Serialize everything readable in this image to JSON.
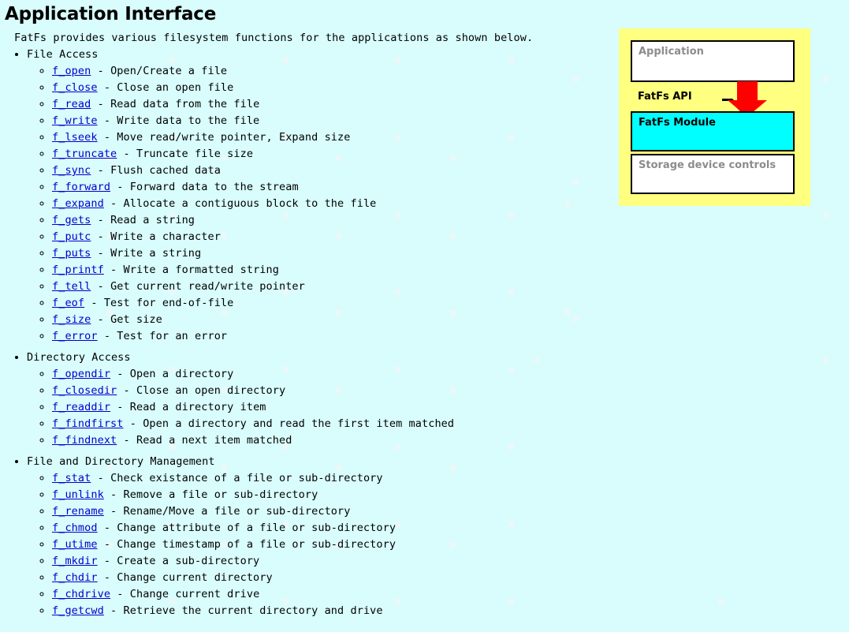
{
  "page": {
    "title": "Application Interface",
    "intro": "FatFs provides various filesystem functions for the applications as shown below.",
    "background_color": "#d9fcfc",
    "link_color": "#0000cc",
    "text_color": "#000000"
  },
  "groups": [
    {
      "label": "File Access",
      "items": [
        {
          "name": "f_open",
          "sep": " - ",
          "desc": "Open/Create a file"
        },
        {
          "name": "f_close",
          "sep": " - ",
          "desc": "Close an open file"
        },
        {
          "name": "f_read",
          "sep": " - ",
          "desc": "Read data from the file"
        },
        {
          "name": "f_write",
          "sep": " - ",
          "desc": "Write data to the file"
        },
        {
          "name": "f_lseek",
          "sep": " - ",
          "desc": "Move read/write pointer, Expand size"
        },
        {
          "name": "f_truncate",
          "sep": " - ",
          "desc": "Truncate file size"
        },
        {
          "name": "f_sync",
          "sep": " - ",
          "desc": "Flush cached data"
        },
        {
          "name": "f_forward",
          "sep": " - ",
          "desc": "Forward data to the stream"
        },
        {
          "name": "f_expand",
          "sep": " - ",
          "desc": "Allocate a contiguous block to the file"
        },
        {
          "name": "f_gets",
          "sep": " - ",
          "desc": "Read a string"
        },
        {
          "name": "f_putc",
          "sep": " - ",
          "desc": "Write a character"
        },
        {
          "name": "f_puts",
          "sep": " - ",
          "desc": "Write a string"
        },
        {
          "name": "f_printf",
          "sep": " - ",
          "desc": "Write a formatted string"
        },
        {
          "name": "f_tell",
          "sep": " - ",
          "desc": "Get current read/write pointer"
        },
        {
          "name": "f_eof",
          "sep": " - ",
          "desc": "Test for end-of-file"
        },
        {
          "name": "f_size",
          "sep": " - ",
          "desc": "Get size"
        },
        {
          "name": "f_error",
          "sep": " - ",
          "desc": "Test for an error"
        }
      ]
    },
    {
      "label": "Directory Access",
      "items": [
        {
          "name": "f_opendir",
          "sep": " - ",
          "desc": "Open a directory"
        },
        {
          "name": "f_closedir",
          "sep": " - ",
          "desc": "Close an open directory"
        },
        {
          "name": "f_readdir",
          "sep": " - ",
          "desc": "Read a directory item"
        },
        {
          "name": "f_findfirst",
          "sep": " - ",
          "desc": "Open a directory and read the first item matched"
        },
        {
          "name": "f_findnext",
          "sep": " - ",
          "desc": "Read a next item matched"
        }
      ]
    },
    {
      "label": "File and Directory Management",
      "items": [
        {
          "name": "f_stat",
          "sep": " - ",
          "desc": "Check existance of a file or sub-directory"
        },
        {
          "name": "f_unlink",
          "sep": " - ",
          "desc": "Remove a file or sub-directory"
        },
        {
          "name": "f_rename",
          "sep": " - ",
          "desc": "Rename/Move a file or sub-directory"
        },
        {
          "name": "f_chmod",
          "sep": " - ",
          "desc": "Change attribute of a file or sub-directory"
        },
        {
          "name": "f_utime",
          "sep": " - ",
          "desc": "Change timestamp of a file or sub-directory"
        },
        {
          "name": "f_mkdir",
          "sep": " - ",
          "desc": "Create a sub-directory"
        },
        {
          "name": "f_chdir",
          "sep": " - ",
          "desc": "Change current directory"
        },
        {
          "name": "f_chdrive",
          "sep": " - ",
          "desc": "Change current drive"
        },
        {
          "name": "f_getcwd",
          "sep": " - ",
          "desc": "Retrieve the current directory and drive"
        }
      ]
    }
  ],
  "diagram": {
    "panel_color": "#ffff80",
    "arrow_color": "#ff0000",
    "api_label": "FatFs API",
    "layers": [
      {
        "label": "Application",
        "fill": "#ffffff",
        "text_color": "#8c8c8c"
      },
      {
        "label": "FatFs Module",
        "fill": "#00ffff",
        "text_color": "#000000"
      },
      {
        "label": "Storage device controls",
        "fill": "#ffffff",
        "text_color": "#8c8c8c"
      }
    ]
  }
}
